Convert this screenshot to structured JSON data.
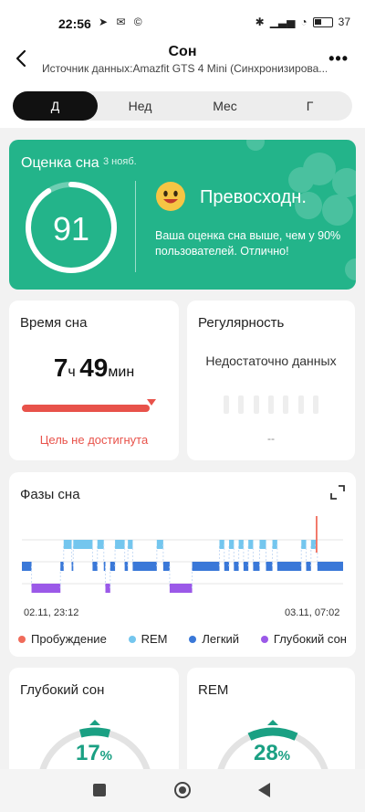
{
  "status_bar": {
    "time": "22:56",
    "battery": "37"
  },
  "header": {
    "title": "Сон",
    "subtitle": "Источник данных:Amazfit GTS 4 Mini (Синхронизирова..."
  },
  "tabs": [
    {
      "label": "Д",
      "active": true
    },
    {
      "label": "Нед",
      "active": false
    },
    {
      "label": "Мес",
      "active": false
    },
    {
      "label": "Г",
      "active": false
    }
  ],
  "score_card": {
    "title": "Оценка сна",
    "date": "3 нояб.",
    "score": "91",
    "score_fraction": 0.91,
    "rating": "Превосходн.",
    "description": "Ваша оценка сна выше, чем у 90% пользователей. Отлично!",
    "color": "#23b48a"
  },
  "duration_card": {
    "title": "Время сна",
    "hours": "7",
    "hours_unit": "ч",
    "minutes": "49",
    "minutes_unit": "мин",
    "goal_status": "Цель не достигнута"
  },
  "regularity_card": {
    "title": "Регулярность",
    "no_data": "Недостаточно данных",
    "dash": "--"
  },
  "phases_card": {
    "title": "Фазы сна",
    "start_time": "02.11, 23:12",
    "end_time": "03.11, 07:02",
    "legend": [
      {
        "label": "Пробуждение",
        "color": "#f06b5a"
      },
      {
        "label": "REM",
        "color": "#74c6ee"
      },
      {
        "label": "Легкий",
        "color": "#3a78d8"
      },
      {
        "label": "Глубокий сон",
        "color": "#9b59e8"
      }
    ]
  },
  "chart_data": {
    "type": "bar",
    "title": "Фазы сна",
    "x_start": "02.11, 23:12",
    "x_end": "03.11, 07:02",
    "stages": [
      "Пробуждение",
      "REM",
      "Легкий",
      "Глубокий сон"
    ],
    "segments": [
      {
        "stage": "Легкий",
        "from": 0.0,
        "to": 0.03
      },
      {
        "stage": "Глубокий сон",
        "from": 0.03,
        "to": 0.12
      },
      {
        "stage": "Легкий",
        "from": 0.12,
        "to": 0.13
      },
      {
        "stage": "REM",
        "from": 0.13,
        "to": 0.155
      },
      {
        "stage": "Легкий",
        "from": 0.155,
        "to": 0.16
      },
      {
        "stage": "REM",
        "from": 0.16,
        "to": 0.22
      },
      {
        "stage": "Легкий",
        "from": 0.22,
        "to": 0.235
      },
      {
        "stage": "REM",
        "from": 0.235,
        "to": 0.255
      },
      {
        "stage": "Легкий",
        "from": 0.255,
        "to": 0.26
      },
      {
        "stage": "Глубокий сон",
        "from": 0.26,
        "to": 0.275
      },
      {
        "stage": "Легкий",
        "from": 0.275,
        "to": 0.29
      },
      {
        "stage": "REM",
        "from": 0.29,
        "to": 0.32
      },
      {
        "stage": "Легкий",
        "from": 0.32,
        "to": 0.33
      },
      {
        "stage": "REM",
        "from": 0.33,
        "to": 0.345
      },
      {
        "stage": "Легкий",
        "from": 0.345,
        "to": 0.42
      },
      {
        "stage": "REM",
        "from": 0.42,
        "to": 0.44
      },
      {
        "stage": "Легкий",
        "from": 0.44,
        "to": 0.46
      },
      {
        "stage": "Глубокий сон",
        "from": 0.46,
        "to": 0.53
      },
      {
        "stage": "Легкий",
        "from": 0.53,
        "to": 0.5
      },
      {
        "stage": "Легкий",
        "from": 0.53,
        "to": 0.615
      },
      {
        "stage": "REM",
        "from": 0.615,
        "to": 0.63
      },
      {
        "stage": "Легкий",
        "from": 0.63,
        "to": 0.645
      },
      {
        "stage": "REM",
        "from": 0.645,
        "to": 0.66
      },
      {
        "stage": "Легкий",
        "from": 0.66,
        "to": 0.675
      },
      {
        "stage": "REM",
        "from": 0.675,
        "to": 0.69
      },
      {
        "stage": "Легкий",
        "from": 0.69,
        "to": 0.705
      },
      {
        "stage": "REM",
        "from": 0.705,
        "to": 0.72
      },
      {
        "stage": "Легкий",
        "from": 0.72,
        "to": 0.74
      },
      {
        "stage": "REM",
        "from": 0.74,
        "to": 0.76
      },
      {
        "stage": "Легкий",
        "from": 0.76,
        "to": 0.78
      },
      {
        "stage": "REM",
        "from": 0.78,
        "to": 0.795
      },
      {
        "stage": "Легкий",
        "from": 0.795,
        "to": 0.87
      },
      {
        "stage": "REM",
        "from": 0.87,
        "to": 0.885
      },
      {
        "stage": "Легкий",
        "from": 0.885,
        "to": 0.9
      },
      {
        "stage": "REM",
        "from": 0.9,
        "to": 0.915
      },
      {
        "stage": "Пробуждение",
        "from": 0.915,
        "to": 0.92
      },
      {
        "stage": "Легкий",
        "from": 0.92,
        "to": 1.0
      }
    ]
  },
  "deep_card": {
    "title": "Глубокий сон",
    "value": "17",
    "unit": "%",
    "fraction": 0.17
  },
  "rem_card": {
    "title": "REM",
    "value": "28",
    "unit": "%",
    "fraction": 0.28
  }
}
